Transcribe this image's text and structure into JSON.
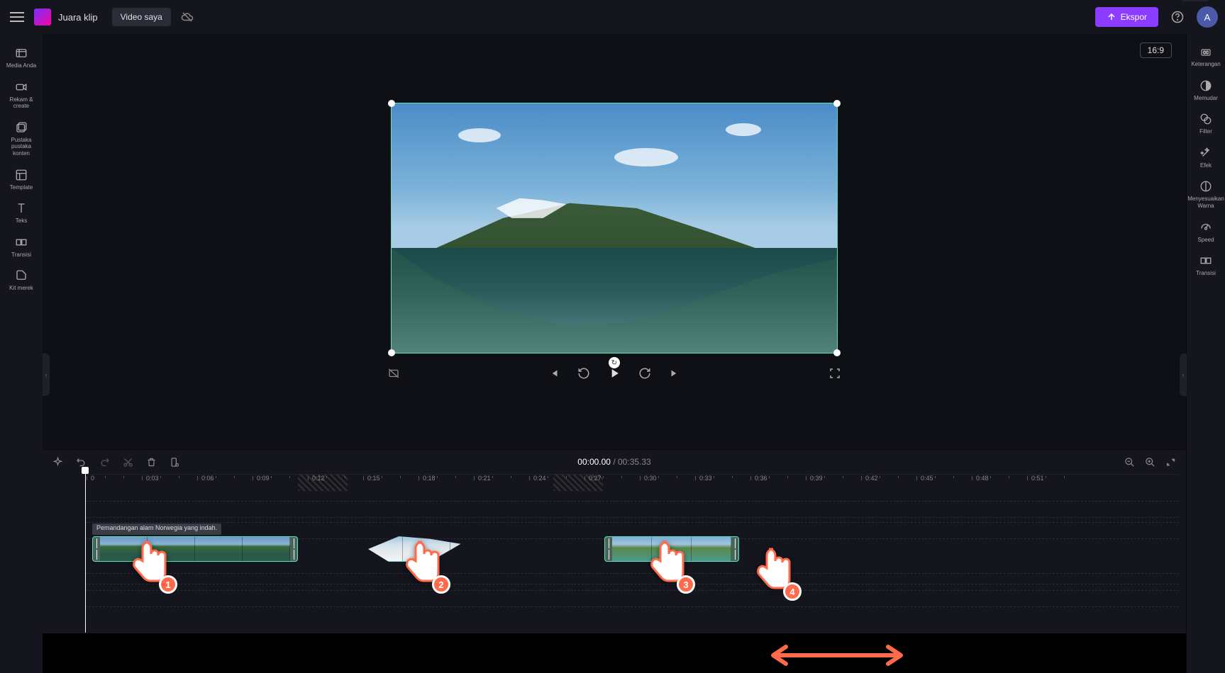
{
  "header": {
    "app_name": "Juara klip",
    "tab": "Video saya",
    "export_label": "Ekspor",
    "avatar_initial": "A"
  },
  "left_nav": {
    "items": [
      {
        "icon": "media",
        "label": "Media Anda"
      },
      {
        "icon": "camera",
        "label": "Rekam &amp;\ncreate"
      },
      {
        "icon": "library",
        "label": "Pustaka pustaka\nkonten"
      },
      {
        "icon": "template",
        "label": "Template"
      },
      {
        "icon": "text",
        "label": "Teks"
      },
      {
        "icon": "transition",
        "label": "Transisi"
      },
      {
        "icon": "brand",
        "label": "Kit merek"
      }
    ]
  },
  "right_nav": {
    "items": [
      {
        "icon": "cc",
        "label": "Keterangan"
      },
      {
        "icon": "fade",
        "label": "Memudar"
      },
      {
        "icon": "filter",
        "label": "Filter"
      },
      {
        "icon": "fx",
        "label": "Efek"
      },
      {
        "icon": "adjust",
        "label": "Menyesuaikan\nWarna"
      },
      {
        "icon": "speed",
        "label": "Speed"
      },
      {
        "icon": "trans",
        "label": "Transisi"
      }
    ]
  },
  "preview": {
    "aspect": "16:9"
  },
  "timeline": {
    "current": "00:00.00",
    "duration": "00:35.33",
    "clip_label": "Pemandangan alam Norwegia yang indah.",
    "ticks": [
      "0",
      "0:03",
      "0:06",
      "0:09",
      "0:12",
      "0:15",
      "0:18",
      "0:21",
      "0:24",
      "0:27",
      "0:30",
      "0:33",
      "0:36",
      "0:39",
      "0:42",
      "0:45",
      "0:48",
      "0:51"
    ]
  },
  "annotations": {
    "pointers": [
      "1",
      "2",
      "3",
      "4"
    ]
  }
}
